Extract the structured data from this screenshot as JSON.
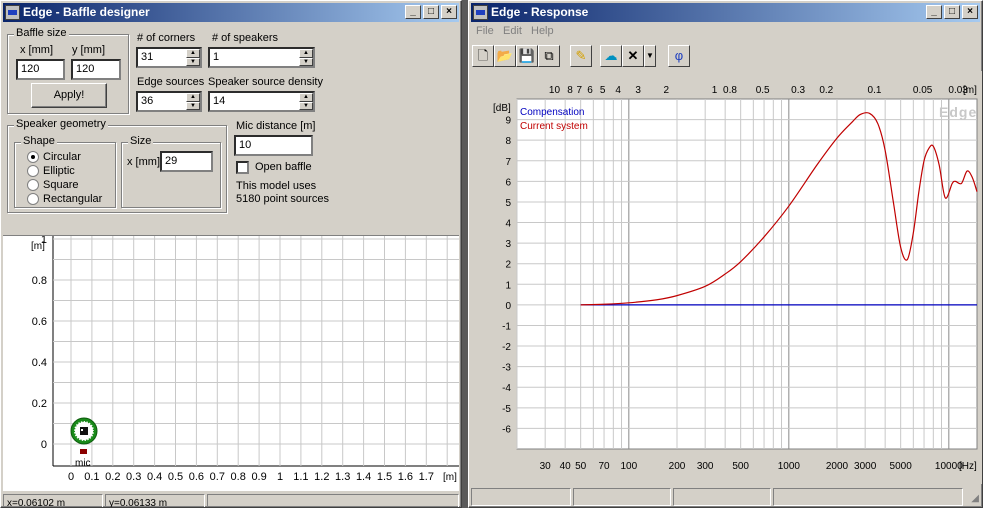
{
  "baffle_window": {
    "title": "Edge - Baffle designer",
    "controls": {
      "minimize": "_",
      "maximize": "□",
      "close": "×"
    },
    "baffle_size": {
      "group_label": "Baffle size",
      "x_label": "x [mm]",
      "y_label": "y [mm]",
      "x_value": "120",
      "y_value": "120",
      "apply_label": "Apply!"
    },
    "corners": {
      "label": "# of corners",
      "value": "31"
    },
    "speakers": {
      "label": "# of speakers",
      "value": "1"
    },
    "edge_sources": {
      "label": "Edge sources",
      "value": "36"
    },
    "speaker_density": {
      "label": "Speaker source density",
      "value": "14"
    },
    "speaker_geometry": {
      "group_label": "Speaker geometry",
      "shape_label": "Shape",
      "shapes": [
        "Circular",
        "Elliptic",
        "Square",
        "Rectangular"
      ],
      "selected_shape": 0,
      "size_label": "Size",
      "size_x_label": "x [mm]",
      "size_x_value": "29"
    },
    "mic_distance": {
      "label": "Mic distance [m]",
      "value": "10"
    },
    "open_baffle": {
      "label": "Open baffle",
      "checked": false
    },
    "model_info": {
      "line1": "This model uses",
      "line2": "5180 point sources"
    },
    "plot": {
      "y_unit": "[m]",
      "x_unit": "[m]",
      "y_ticks": [
        "1",
        "0.8",
        "0.6",
        "0.4",
        "0.2",
        "0"
      ],
      "x_ticks": [
        "0",
        "0.1",
        "0.2",
        "0.3",
        "0.4",
        "0.5",
        "0.6",
        "0.7",
        "0.8",
        "0.9",
        "1",
        "1.1",
        "1.2",
        "1.3",
        "1.4",
        "1.5",
        "1.6",
        "1.7"
      ],
      "mic_label": "mic"
    },
    "status": {
      "x": "x=0.06102 m",
      "y": "y=0.06133 m"
    }
  },
  "response_window": {
    "title": "Edge - Response",
    "controls": {
      "minimize": "_",
      "maximize": "□",
      "close": "×"
    },
    "menu": [
      "File",
      "Edit",
      "Help"
    ],
    "toolbar": {
      "new": "new-file-icon",
      "open": "open-folder-icon",
      "save": "save-disk-icon",
      "copy": "copy-icon",
      "pencil": "pencil-icon",
      "compensation": "network-icon",
      "delete": "delete-x-icon",
      "dropdown": "dropdown-arrow-icon",
      "phase": "φ"
    },
    "watermark": "Edge",
    "legend": [
      {
        "name": "Compensation",
        "color": "#0000c0"
      },
      {
        "name": "Current system",
        "color": "#c00000"
      }
    ],
    "top_axis": {
      "unit": "[m]",
      "ticks": [
        "10",
        "8",
        "7",
        "6",
        "5",
        "4",
        "3",
        "2",
        "1",
        "0.8",
        "0.5",
        "0.3",
        "0.2",
        "0.1",
        "0.05",
        "0.03"
      ]
    },
    "bottom_axis": {
      "unit": "[Hz]",
      "ticks": [
        "30",
        "40",
        "50",
        "70",
        "100",
        "200",
        "300",
        "500",
        "1000",
        "2000",
        "3000",
        "5000",
        "10000"
      ]
    },
    "y_axis": {
      "unit": "[dB]"
    }
  },
  "chart_data": {
    "type": "line",
    "title": "",
    "xlabel": "[Hz]",
    "ylabel": "[dB]",
    "x_scale": "log",
    "xlim": [
      20,
      15000
    ],
    "ylim": [
      -7,
      10
    ],
    "y_ticks": [
      9,
      8,
      7,
      6,
      5,
      4,
      3,
      2,
      1,
      0,
      -1,
      -2,
      -3,
      -4,
      -5,
      -6
    ],
    "grid": true,
    "legend": "top-left",
    "series": [
      {
        "name": "Compensation",
        "color": "#0000c0",
        "x": [
          50,
          15000
        ],
        "y": [
          0,
          0
        ]
      },
      {
        "name": "Current system",
        "color": "#c00000",
        "x": [
          50,
          70,
          100,
          150,
          200,
          300,
          400,
          500,
          700,
          1000,
          1500,
          2000,
          2500,
          2800,
          3200,
          3600,
          4000,
          4500,
          5000,
          5500,
          6000,
          6500,
          7000,
          7500,
          8000,
          8700,
          9500,
          10500,
          11000,
          12000,
          13000,
          14000,
          15000
        ],
        "y": [
          0,
          0.03,
          0.1,
          0.25,
          0.45,
          0.9,
          1.5,
          2.1,
          3.3,
          4.8,
          6.8,
          8.1,
          8.9,
          9.25,
          9.3,
          8.8,
          7.5,
          5.0,
          2.8,
          2.2,
          3.5,
          5.5,
          7.0,
          7.6,
          7.7,
          6.8,
          5.2,
          5.9,
          6.0,
          5.9,
          6.5,
          6.2,
          5.5
        ]
      }
    ]
  }
}
